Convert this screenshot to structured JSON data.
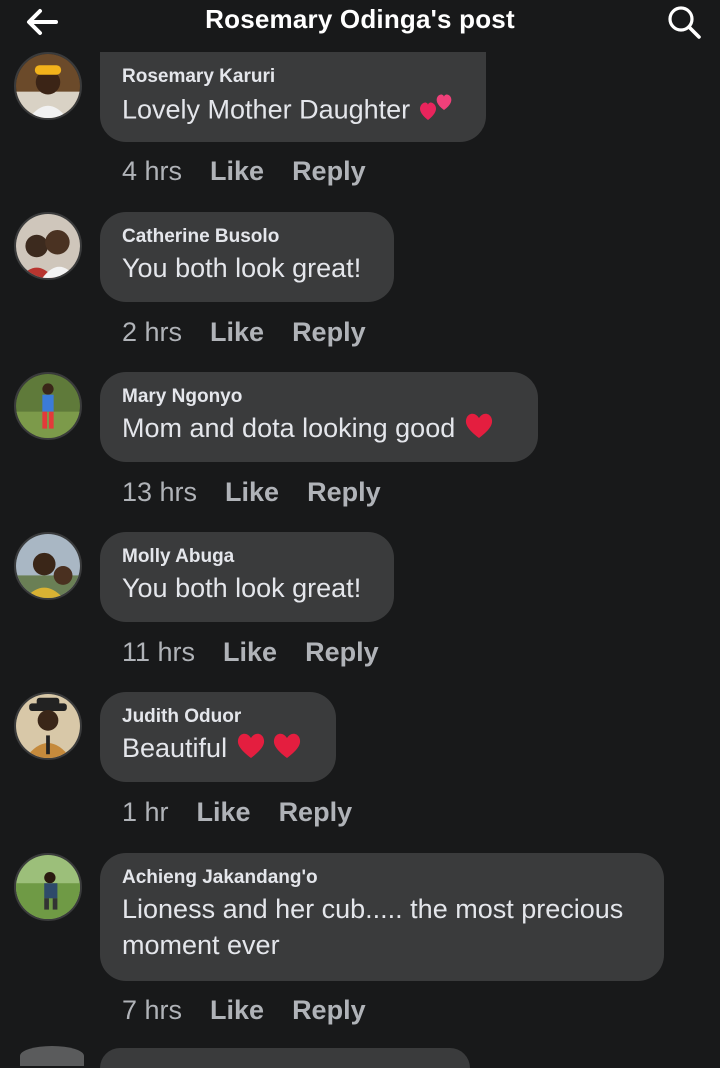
{
  "header": {
    "title": "Rosemary Odinga's post",
    "back_icon": "arrow-left-icon",
    "search_icon": "search-icon"
  },
  "colors": {
    "background": "#18191a",
    "bubble": "#3a3b3c",
    "text": "#e4e6eb",
    "secondary_text": "#b0b3b8",
    "heart": "#e41e3f"
  },
  "comments": [
    {
      "author": "Rosemary Karuri",
      "text": "Lovely Mother Daughter",
      "emoji": "two-hearts-icon",
      "time": "4 hrs",
      "like": "Like",
      "reply": "Reply"
    },
    {
      "author": "Catherine Busolo",
      "text": "You both look great!",
      "time": "2 hrs",
      "like": "Like",
      "reply": "Reply"
    },
    {
      "author": "Mary Ngonyo",
      "text": "Mom and dota looking good",
      "emoji": "red-heart-icon",
      "time": "13 hrs",
      "like": "Like",
      "reply": "Reply"
    },
    {
      "author": "Molly Abuga",
      "text": "You both look great!",
      "time": "11 hrs",
      "like": "Like",
      "reply": "Reply"
    },
    {
      "author": "Judith Oduor",
      "text": "Beautiful",
      "emoji": "two-red-hearts-icon",
      "time": "1 hr",
      "like": "Like",
      "reply": "Reply"
    },
    {
      "author": "Achieng Jakandang'o",
      "text_line1": "Lioness and her cub..... the most precious",
      "text_line2": "moment ever",
      "time": "7 hrs",
      "like": "Like",
      "reply": "Reply"
    }
  ]
}
